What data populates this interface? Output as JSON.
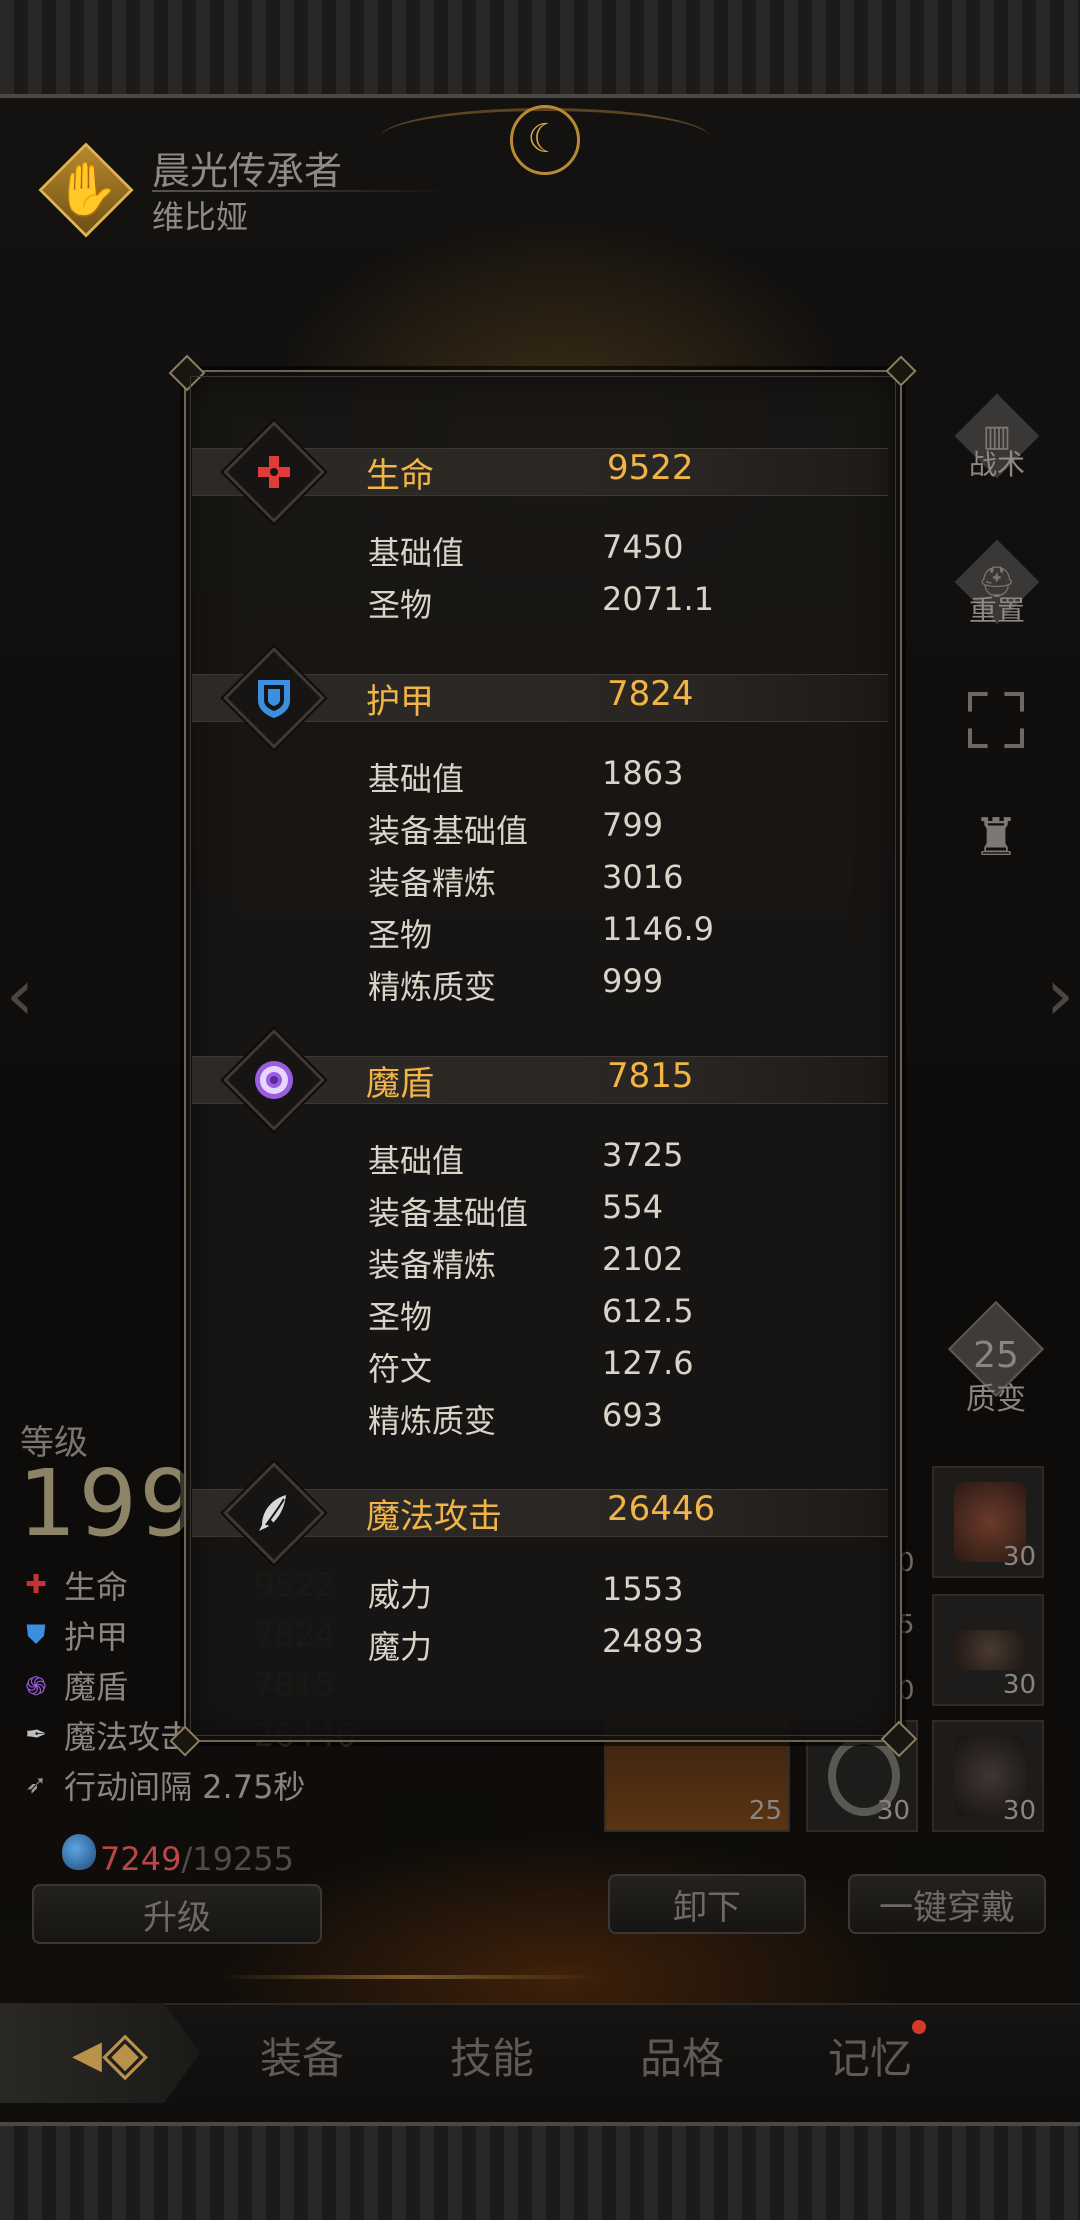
{
  "header": {
    "title": "晨光传承者",
    "name": "维比娅"
  },
  "side_buttons": {
    "tactics": "战术",
    "reset": "重置"
  },
  "transmute": {
    "value": "25",
    "label": "质变"
  },
  "level": {
    "label": "等级",
    "value": "199"
  },
  "mini_stats": [
    {
      "icon": "cross-icon",
      "label": "生命",
      "value": "9522"
    },
    {
      "icon": "shield-icon",
      "label": "护甲",
      "value": "7824"
    },
    {
      "icon": "swirl-icon",
      "label": "魔盾",
      "value": "7815"
    },
    {
      "icon": "feather-icon",
      "label": "魔法攻击",
      "value": "26446"
    },
    {
      "icon": "wing-icon",
      "label": "行动间隔 2.75秒",
      "value": ""
    }
  ],
  "exp": {
    "current": "7249",
    "separator": "/",
    "max": "19255"
  },
  "buttons": {
    "upgrade": "升级",
    "unequip": "卸下",
    "equip_all": "一键穿戴"
  },
  "gear_slots": [
    {
      "name": "armor",
      "quality": "30"
    },
    {
      "name": "belt",
      "quality": "30"
    },
    {
      "name": "ring",
      "quality": "30"
    },
    {
      "name": "boots",
      "quality": "30"
    }
  ],
  "gear_under": {
    "left_a": "0",
    "left_b": "0",
    "left_c": "25",
    "left_d": "5"
  },
  "nav": {
    "tabs": [
      "装备",
      "技能",
      "品格",
      "记忆"
    ]
  },
  "popup": {
    "sections": [
      {
        "name": "生命",
        "total": "9522",
        "color": "#e23a3a",
        "rows": [
          {
            "label": "基础值",
            "value": "7450"
          },
          {
            "label": "圣物",
            "value": "2071.1"
          }
        ]
      },
      {
        "name": "护甲",
        "total": "7824",
        "color": "#3a8fe0",
        "rows": [
          {
            "label": "基础值",
            "value": "1863"
          },
          {
            "label": "装备基础值",
            "value": "799"
          },
          {
            "label": "装备精炼",
            "value": "3016"
          },
          {
            "label": "圣物",
            "value": "1146.9"
          },
          {
            "label": "精炼质变",
            "value": "999"
          }
        ]
      },
      {
        "name": "魔盾",
        "total": "7815",
        "color": "#9b5de0",
        "rows": [
          {
            "label": "基础值",
            "value": "3725"
          },
          {
            "label": "装备基础值",
            "value": "554"
          },
          {
            "label": "装备精炼",
            "value": "2102"
          },
          {
            "label": "圣物",
            "value": "612.5"
          },
          {
            "label": "符文",
            "value": "127.6"
          },
          {
            "label": "精炼质变",
            "value": "693"
          }
        ]
      },
      {
        "name": "魔法攻击",
        "total": "26446",
        "color": "#cfcfcf",
        "rows": [
          {
            "label": "威力",
            "value": "1553"
          },
          {
            "label": "魔力",
            "value": "24893"
          }
        ]
      }
    ]
  }
}
